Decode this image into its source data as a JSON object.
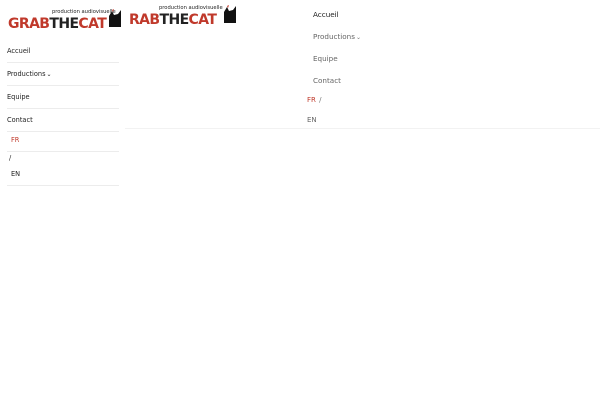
{
  "logo": {
    "wordmark_left": "GRABTHECAT",
    "wordmark_right": "RABTHECAT",
    "tagline": "production audiovisuelle",
    "accent_color": "#c0392b"
  },
  "mobile_menu": {
    "items": [
      {
        "label": "Accueil"
      },
      {
        "label": "Productions",
        "has_dropdown": true,
        "icon": "chevron-down-icon"
      },
      {
        "label": "Equipe"
      },
      {
        "label": "Contact"
      }
    ],
    "lang": {
      "fr": "FR",
      "separator": "/",
      "en": "EN"
    }
  },
  "desktop_menu": {
    "items": [
      {
        "label": "Accueil"
      },
      {
        "label": "Productions",
        "has_dropdown": true,
        "icon": "chevron-down-icon"
      },
      {
        "label": "Equipe"
      },
      {
        "label": "Contact"
      }
    ],
    "lang": {
      "fr": "FR",
      "separator": "/",
      "en": "EN"
    }
  }
}
